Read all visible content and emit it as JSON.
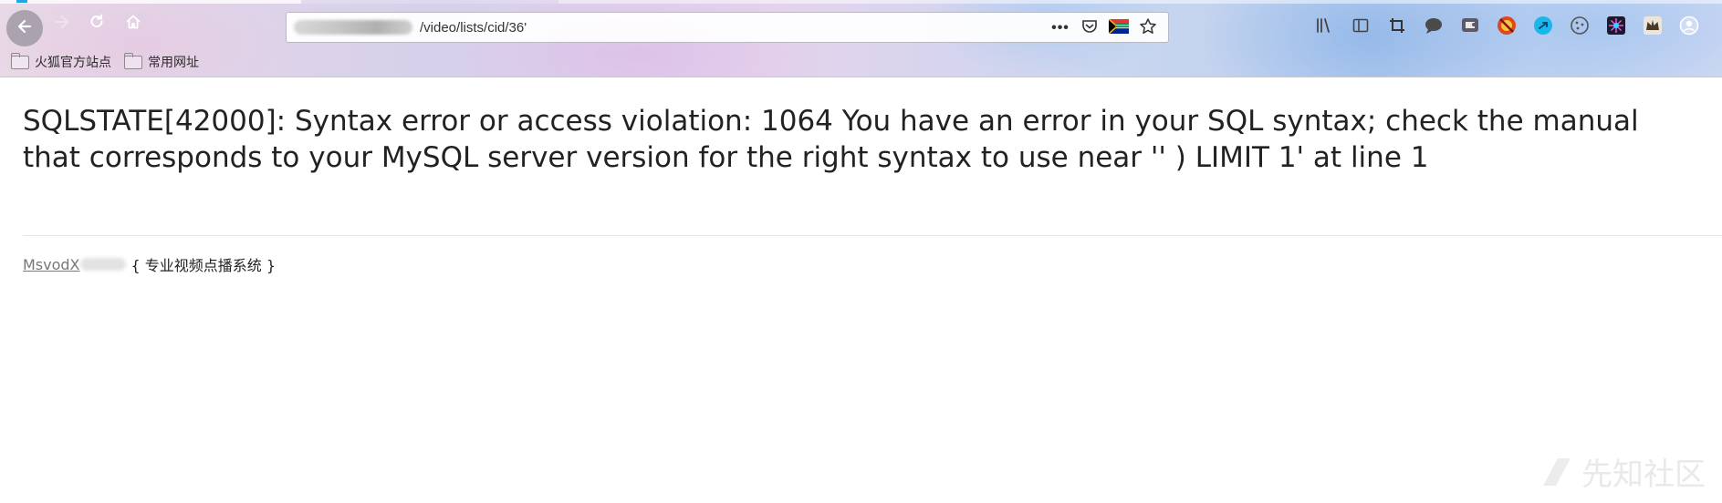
{
  "browser": {
    "url_visible": "/video/lists/cid/36'",
    "page_actions_label": "•••",
    "bookmarks": [
      {
        "label": "火狐官方站点"
      },
      {
        "label": "常用网址"
      }
    ],
    "accent_color": "#1ea7e1"
  },
  "page": {
    "error_message": "SQLSTATE[42000]: Syntax error or access violation: 1064 You have an error in your SQL syntax; check the manual that corresponds to your MySQL server version for the right syntax to use near '' ) LIMIT 1' at line 1",
    "footer": {
      "link_text": "MsvodX",
      "tagline": "{ 专业视频点播系统 }"
    },
    "watermark": "先知社区"
  },
  "icons": {
    "back": "back-arrow-icon",
    "forward": "forward-arrow-icon",
    "reload": "reload-icon",
    "home": "home-icon",
    "pocket": "pocket-icon",
    "flag": "south-africa-flag-icon",
    "bookmark_star": "star-icon",
    "library": "library-icon",
    "sidebar": "sidebar-icon",
    "crop": "crop-icon",
    "chat": "chat-bubble-icon",
    "screenshot": "screenshot-icon",
    "blocker": "no-entry-icon",
    "extension_blue": "blue-arrow-extension-icon",
    "cookie": "cookie-icon",
    "burst": "burst-extension-icon",
    "crown": "crown-extension-icon",
    "account": "account-icon"
  }
}
